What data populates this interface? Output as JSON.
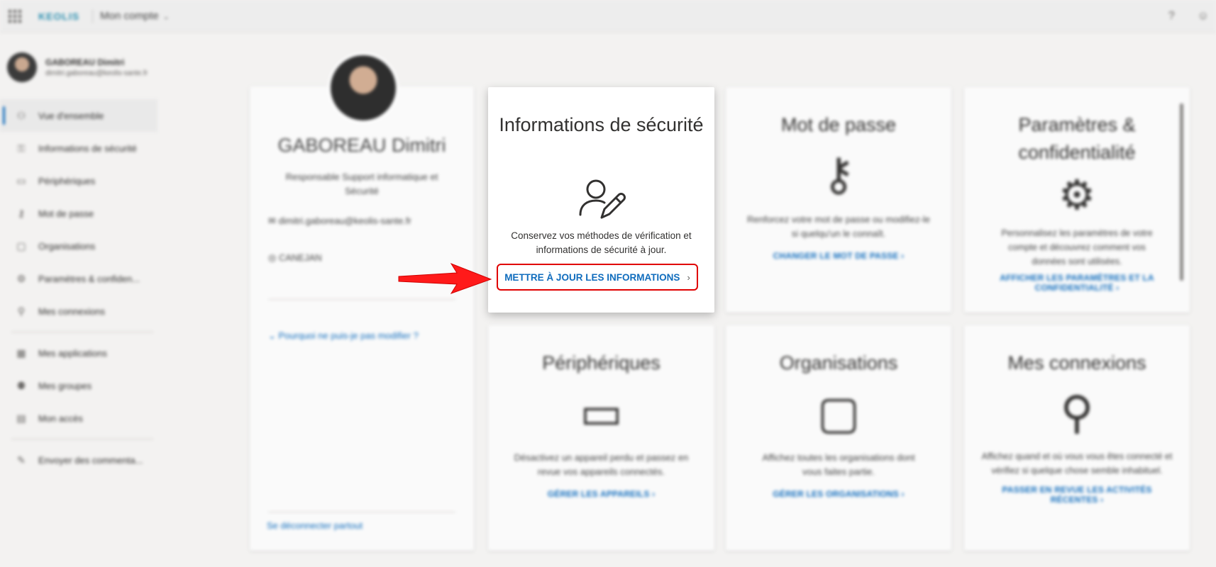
{
  "topbar": {
    "logo_part1": "KEOLIS",
    "logo_part2": "",
    "title": "Mon compte",
    "icons": [
      "grid-icon",
      "help-icon",
      "person-icon"
    ]
  },
  "sidebar": {
    "user_name": "GABOREAU Dimitri",
    "user_email": "dimitri.gaboreau@keolis-sante.fr",
    "items": [
      {
        "label": "Vue d'ensemble",
        "icon": "person-icon"
      },
      {
        "label": "Informations de sécurité",
        "icon": "shield-key-icon"
      },
      {
        "label": "Périphériques",
        "icon": "laptop-icon"
      },
      {
        "label": "Mot de passe",
        "icon": "key-icon"
      },
      {
        "label": "Organisations",
        "icon": "briefcase-icon"
      },
      {
        "label": "Paramètres & confiden...",
        "icon": "gear-icon"
      },
      {
        "label": "Mes connexions",
        "icon": "person-key-icon"
      },
      {
        "label": "Mes applications",
        "icon": "apps-icon"
      },
      {
        "label": "Mes groupes",
        "icon": "group-icon"
      },
      {
        "label": "Mon accès",
        "icon": "access-icon"
      },
      {
        "label": "Envoyer des commenta...",
        "icon": "feedback-icon"
      }
    ]
  },
  "profile": {
    "name": "GABOREAU Dimitri",
    "role": "Responsable Support informatique et Sécurité",
    "email": "dimitri.gaboreau@keolis-sante.fr",
    "location": "CANEJAN",
    "why_link": "Pourquoi ne puis-je pas modifier ?",
    "logout": "Se déconnecter partout"
  },
  "security_card": {
    "title": "Informations de sécurité",
    "description": "Conservez vos méthodes de vérification et informations de sécurité à jour.",
    "link": "METTRE À JOUR LES INFORMATIONS",
    "link_chevron": "›"
  },
  "cards": {
    "password": {
      "title": "Mot de passe",
      "description": "Renforcez votre mot de passe ou modifiez-le si quelqu'un le connaît.",
      "link": "CHANGER LE MOT DE PASSE ›"
    },
    "settings": {
      "title": "Paramètres & confidentialité",
      "description": "Personnalisez les paramètres de votre compte et découvrez comment vos données sont utilisées.",
      "link": "AFFICHER LES PARAMÈTRES ET LA CONFIDENTIALITÉ ›"
    },
    "devices": {
      "title": "Périphériques",
      "description": "Désactivez un appareil perdu et passez en revue vos appareils connectés.",
      "link": "GÉRER LES APPAREILS ›"
    },
    "organizations": {
      "title": "Organisations",
      "description": "Affichez toutes les organisations dont vous faites partie.",
      "link": "GÉRER LES ORGANISATIONS ›"
    },
    "signins": {
      "title": "Mes connexions",
      "description": "Affichez quand et où vous vous êtes connecté et vérifiez si quelque chose semble inhabituel.",
      "link": "PASSER EN REVUE LES ACTIVITÉS RÉCENTES ›"
    }
  },
  "colors": {
    "accent": "#0f6cbd",
    "highlight_border": "#e00000",
    "arrow": "#ff1a1a"
  }
}
